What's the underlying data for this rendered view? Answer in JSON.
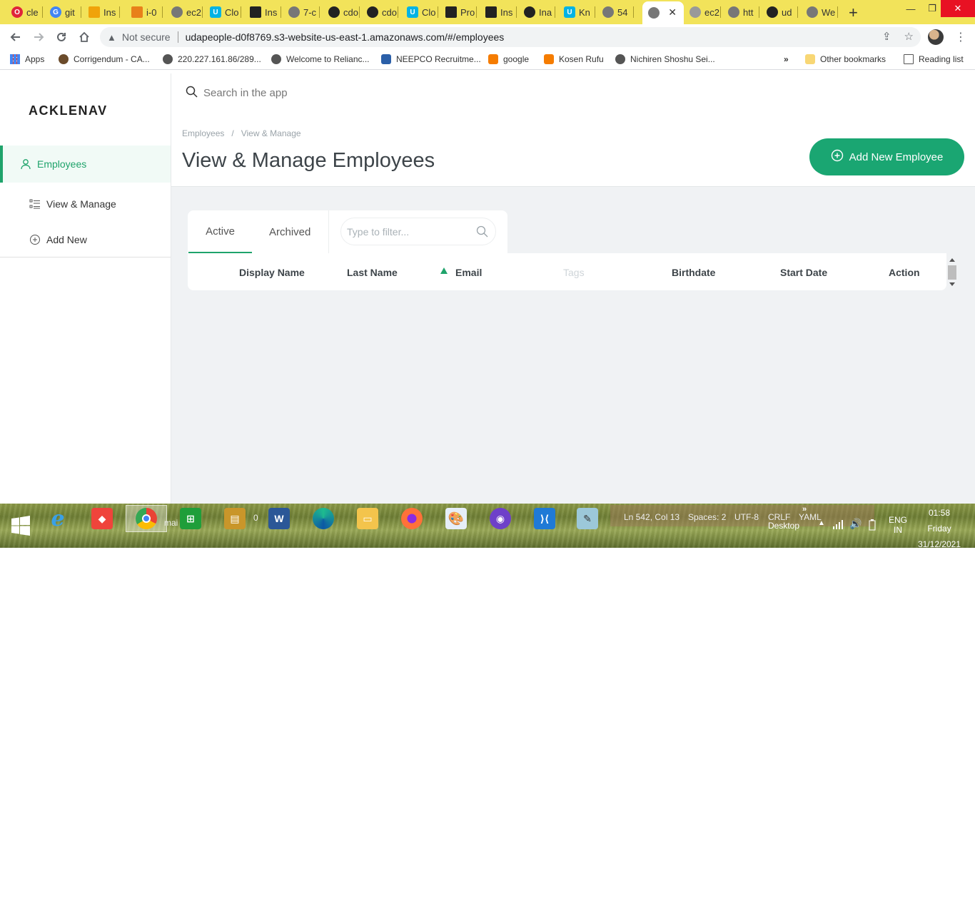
{
  "browser": {
    "tabs": [
      {
        "label": "cle",
        "icon": "opera-icon",
        "color": "#e0243a"
      },
      {
        "label": "git",
        "icon": "google-icon",
        "color": "#4285f4"
      },
      {
        "label": "Ins",
        "icon": "box-icon",
        "color": "#f0a30a"
      },
      {
        "label": "i-0",
        "icon": "aws-cube-icon",
        "color": "#e8801a"
      },
      {
        "label": "ec2",
        "icon": "globe-icon",
        "color": "#777777"
      },
      {
        "label": "Clo",
        "icon": "udacity-icon",
        "color": "#02b3e4"
      },
      {
        "label": "Ins",
        "icon": "terminal-icon",
        "color": "#222222"
      },
      {
        "label": "7-c",
        "icon": "globe-icon",
        "color": "#777777"
      },
      {
        "label": "cdo",
        "icon": "github-icon",
        "color": "#222222"
      },
      {
        "label": "cdo",
        "icon": "github-icon",
        "color": "#222222"
      },
      {
        "label": "Clo",
        "icon": "udacity-icon",
        "color": "#02b3e4"
      },
      {
        "label": "Pro",
        "icon": "terminal-icon",
        "color": "#222222"
      },
      {
        "label": "Ins",
        "icon": "terminal-icon",
        "color": "#222222"
      },
      {
        "label": "Ina",
        "icon": "github-icon",
        "color": "#222222"
      },
      {
        "label": "Kn",
        "icon": "udacity-icon",
        "color": "#02b3e4"
      },
      {
        "label": "54",
        "icon": "globe-icon",
        "color": "#777777"
      },
      {
        "label": "",
        "icon": "globe-icon",
        "color": "#777777",
        "active": true
      },
      {
        "label": "ec2",
        "icon": "globe-icon",
        "color": "#777777"
      },
      {
        "label": "htt",
        "icon": "globe-icon",
        "color": "#777777"
      },
      {
        "label": "ud",
        "icon": "github-icon",
        "color": "#222222"
      },
      {
        "label": "We",
        "icon": "globe-icon",
        "color": "#777777"
      }
    ],
    "security_label": "Not secure",
    "url": "udapeople-d0f8769.s3-website-us-east-1.amazonaws.com/#/employees",
    "bookmarks": [
      {
        "label": "Apps",
        "color": "#4285f4"
      },
      {
        "label": "Corrigendum - CA...",
        "color": "#6b4b2b"
      },
      {
        "label": "220.227.161.86/289...",
        "color": "#555555"
      },
      {
        "label": "Welcome to Relianc...",
        "color": "#555555"
      },
      {
        "label": "NEEPCO Recruitme...",
        "color": "#2b5fa8"
      },
      {
        "label": "google",
        "color": "#f57c00"
      },
      {
        "label": "Kosen Rufu",
        "color": "#f57c00"
      },
      {
        "label": "Nichiren Shoshu Sei...",
        "color": "#555555"
      }
    ],
    "overflow_label": "»",
    "other_bookmarks": "Other bookmarks",
    "reading_list": "Reading list"
  },
  "app": {
    "logo": "ACKLENAV",
    "search_placeholder": "Search in the app",
    "nav": {
      "section": "Employees",
      "items": [
        {
          "label": "View & Manage"
        },
        {
          "label": "Add New"
        }
      ]
    },
    "breadcrumb": [
      "Employees",
      "/",
      "View & Manage"
    ],
    "page_title": "View & Manage Employees",
    "add_button": "Add New Employee",
    "tabs": [
      "Active",
      "Archived"
    ],
    "filter_placeholder": "Type to filter...",
    "columns": [
      "Display Name",
      "Last Name",
      "Email",
      "Tags",
      "Birthdate",
      "Start Date",
      "Action"
    ],
    "accent_color": "#1aa672"
  },
  "taskbar": {
    "vscode_status": {
      "position": "Ln 542, Col 13",
      "spaces": "Spaces: 2",
      "encoding": "UTF-8",
      "eol": "CRLF",
      "language": "YAML",
      "extra": "mai",
      "count": "0"
    },
    "desktop_label": "Desktop",
    "desktop_chevron": "»",
    "language": "ENG",
    "region": "IN",
    "time": "01:58",
    "day": "Friday",
    "date": "31/12/2021"
  }
}
